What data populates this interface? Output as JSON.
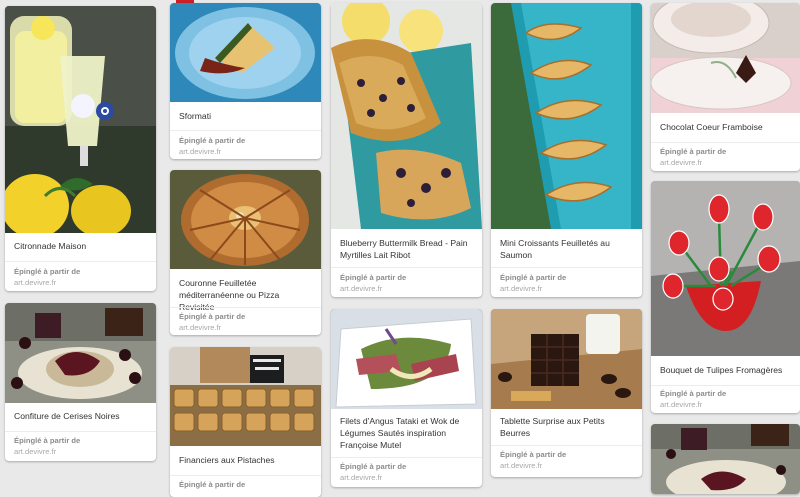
{
  "icons": [
    "photo-image"
  ],
  "via_label": "Épinglé à partir de",
  "source": "art.devivre.fr",
  "pins": [
    {
      "id": "citronnade",
      "title": "Citronnade Maison",
      "image": "lemonade-photo"
    },
    {
      "id": "confiture",
      "title": "Confiture de Cerises Noires",
      "image": "cherry-jam-photo"
    },
    {
      "id": "sformati",
      "title": "Sformati",
      "image": "sformati-photo"
    },
    {
      "id": "couronne",
      "title": "Couronne Feuilletée méditerranéenne ou Pizza Revisitée",
      "image": "puff-crown-photo"
    },
    {
      "id": "financiers",
      "title": "Financiers aux Pistaches",
      "image": "financiers-photo"
    },
    {
      "id": "blueberry",
      "title": "Blueberry Buttermilk Bread - Pain Myrtilles Lait Ribot",
      "image": "blueberry-bread-photo"
    },
    {
      "id": "filets",
      "title": "Filets d'Angus Tataki et Wok de Légumes Sautés inspiration Françoise Mutel",
      "image": "angus-tataki-photo"
    },
    {
      "id": "croissants",
      "title": "Mini Croissants Feuilletés au Saumon",
      "image": "mini-croissants-photo"
    },
    {
      "id": "tablette",
      "title": "Tablette Surprise aux Petits Beurres",
      "image": "chocolate-bar-photo"
    },
    {
      "id": "chocolat",
      "title": "Chocolat Coeur Framboise",
      "image": "chocolate-heart-photo"
    },
    {
      "id": "tulipes",
      "title": "Bouquet de Tulipes Fromagères",
      "image": "tulip-bouquet-photo"
    },
    {
      "id": "confiture2",
      "title": "",
      "image": "cherry-jam-photo-2"
    }
  ]
}
